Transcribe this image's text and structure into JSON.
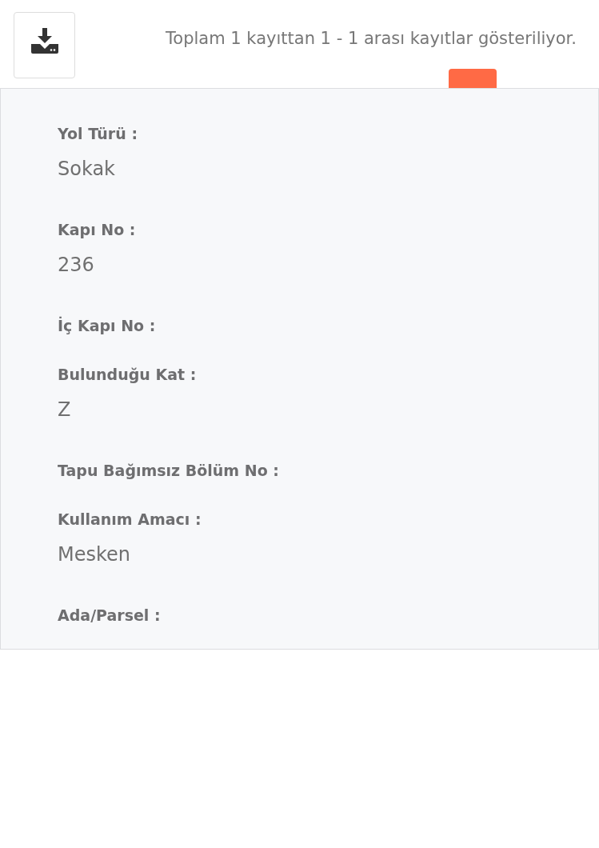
{
  "summary": "Toplam 1 kayıttan 1 - 1 arası kayıtlar gösteriliyor.",
  "details": [
    {
      "label": "Yol Türü :",
      "value": "Sokak"
    },
    {
      "label": "Kapı No :",
      "value": "236"
    },
    {
      "label": "İç Kapı No :"
    },
    {
      "label": "Bulunduğu Kat :",
      "value": "Z"
    },
    {
      "label": "Tapu Bağımsız Bölüm No :"
    },
    {
      "label": "Kullanım Amacı :",
      "value": "Mesken"
    },
    {
      "label": "Ada/Parsel :"
    }
  ]
}
